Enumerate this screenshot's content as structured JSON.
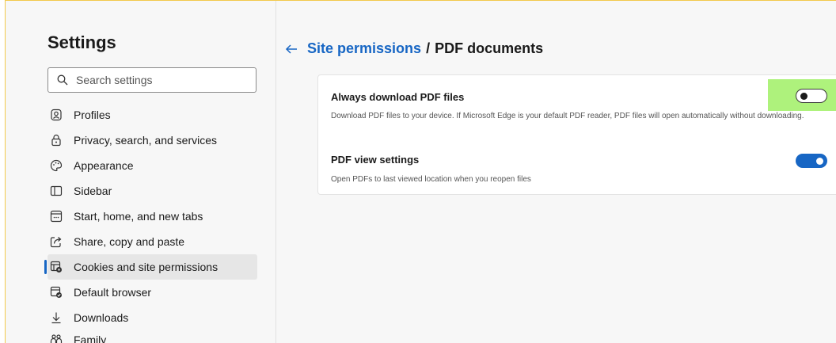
{
  "sidebar": {
    "title": "Settings",
    "search_placeholder": "Search settings",
    "items": [
      {
        "label": "Profiles",
        "icon": "profile-icon"
      },
      {
        "label": "Privacy, search, and services",
        "icon": "lock-icon"
      },
      {
        "label": "Appearance",
        "icon": "palette-icon"
      },
      {
        "label": "Sidebar",
        "icon": "sidebar-icon"
      },
      {
        "label": "Start, home, and new tabs",
        "icon": "home-tabs-icon"
      },
      {
        "label": "Share, copy and paste",
        "icon": "share-icon"
      },
      {
        "label": "Cookies and site permissions",
        "icon": "cookies-permissions-icon",
        "active": true
      },
      {
        "label": "Default browser",
        "icon": "default-browser-icon"
      },
      {
        "label": "Downloads",
        "icon": "download-icon"
      },
      {
        "label": "Family",
        "icon": "family-icon"
      }
    ]
  },
  "main": {
    "breadcrumb": {
      "parent": "Site permissions",
      "separator": "/",
      "current": "PDF documents"
    },
    "settings": [
      {
        "title": "Always download PDF files",
        "description": "Download PDF files to your device. If Microsoft Edge is your default PDF reader, PDF files will open automatically without downloading.",
        "enabled": false
      },
      {
        "title": "PDF view settings",
        "description": "Open PDFs to last viewed location when you reopen files",
        "enabled": true
      }
    ]
  },
  "colors": {
    "accent": "#1766c4",
    "highlight": "#aef27c",
    "frame_border": "#f2c94c"
  }
}
